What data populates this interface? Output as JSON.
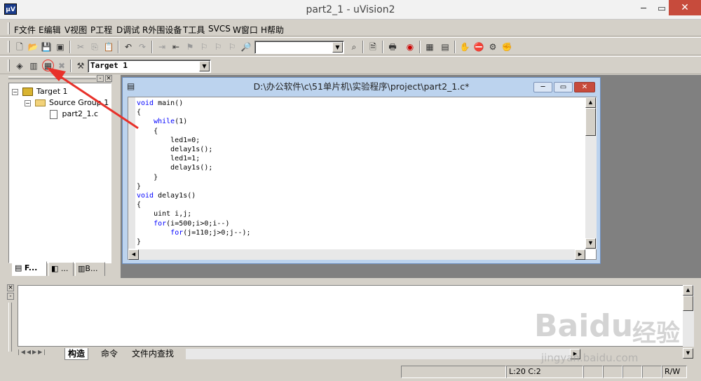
{
  "window": {
    "title": "part2_1  - uVision2",
    "icon_text": "μV"
  },
  "menu": [
    {
      "label": "F文件"
    },
    {
      "label": "E编辑"
    },
    {
      "label": "V视图"
    },
    {
      "label": "P工程"
    },
    {
      "label": "D调试"
    },
    {
      "label": "R外围设备"
    },
    {
      "label": "T工具"
    },
    {
      "label": "SVCS"
    },
    {
      "label": "W窗口"
    },
    {
      "label": "H帮助"
    }
  ],
  "toolbar2": {
    "target_select": "Target 1"
  },
  "project": {
    "target": "Target 1",
    "group": "Source Group 1",
    "file": "part2_1.c",
    "tabs": [
      "F...",
      "...",
      "B..."
    ]
  },
  "editor": {
    "title": "D:\\办公软件\\c\\51单片机\\实验程序\\project\\part2_1.c*",
    "lines": [
      "void main()",
      "{",
      "    while(1)",
      "    {",
      "        led1=0;",
      "        delay1s();",
      "        led1=1;",
      "        delay1s();",
      "    }",
      "}",
      "void delay1s()",
      "{",
      "    uint i,j;",
      "    for(i=500;i>0;i--)",
      "        for(j=110;j>0;j--);",
      "}"
    ]
  },
  "output": {
    "tabs": [
      "构造",
      "命令",
      "文件内查找"
    ]
  },
  "status": {
    "position": "L:20 C:2",
    "mode": "R/W"
  },
  "watermark": {
    "brand": "Baidu",
    "brand_cn": "经验",
    "url": "jingyan.baidu.com"
  },
  "colors": {
    "accent_red": "#e8312a",
    "close": "#c74b3c",
    "keyword": "#0000ff"
  }
}
